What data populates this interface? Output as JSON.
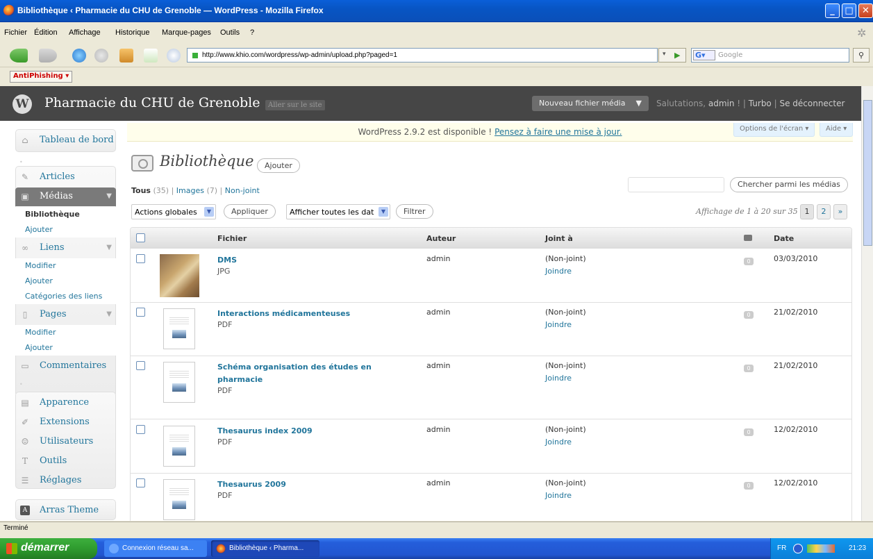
{
  "window": {
    "title": "Bibliothèque ‹ Pharmacie du CHU de Grenoble — WordPress - Mozilla Firefox"
  },
  "menubar": [
    "Fichier",
    "Édition",
    "Affichage",
    "Historique",
    "Marque-pages",
    "Outils",
    "?"
  ],
  "navbar": {
    "url": "http://www.khio.com/wordpress/wp-admin/upload.php?paged=1",
    "search_engine": "G",
    "search_placeholder": "Google"
  },
  "toolbar2": {
    "antiphishing": "AntiPhishing"
  },
  "wp": {
    "site_title": "Pharmacie du CHU de Grenoble",
    "visit_site": "Aller sur le site",
    "new_media": "Nouveau fichier média",
    "greeting": "Salutations,",
    "user": "admin",
    "turbo": "Turbo",
    "logout": "Se déconnecter",
    "update_nag_text": "WordPress 2.9.2 est disponible !",
    "update_nag_link": "Pensez à faire une mise à jour.",
    "screen_options": "Options de l'écran",
    "help": "Aide"
  },
  "sidebar": {
    "dashboard": "Tableau de bord",
    "articles": "Articles",
    "medias": "Médias",
    "medias_sub": [
      "Bibliothèque",
      "Ajouter"
    ],
    "liens": "Liens",
    "liens_sub": [
      "Modifier",
      "Ajouter",
      "Catégories des liens"
    ],
    "pages": "Pages",
    "pages_sub": [
      "Modifier",
      "Ajouter"
    ],
    "commentaires": "Commentaires",
    "apparence": "Apparence",
    "extensions": "Extensions",
    "utilisateurs": "Utilisateurs",
    "outils": "Outils",
    "reglages": "Réglages",
    "theme": "Arras Theme"
  },
  "main": {
    "title": "Bibliothèque",
    "add_button": "Ajouter",
    "filters": {
      "all": "Tous",
      "all_count": "(35)",
      "images": "Images",
      "images_count": "(7)",
      "unattached": "Non-joint"
    },
    "search_button": "Chercher parmi les médias",
    "bulk_actions": "Actions globales",
    "apply": "Appliquer",
    "date_filter": "Afficher toutes les dat",
    "filter_button": "Filtrer",
    "pagination_info": "Affichage de 1 à 20 sur 35",
    "pages": [
      "1",
      "2",
      "»"
    ],
    "columns": {
      "file": "Fichier",
      "author": "Auteur",
      "attached": "Joint à",
      "date": "Date"
    },
    "rows": [
      {
        "name": "DMS",
        "type": "JPG",
        "author": "admin",
        "attached": "(Non-joint)",
        "attach_link": "Joindre",
        "comments": "0",
        "date": "03/03/2010",
        "thumb": "photo"
      },
      {
        "name": "Interactions médicamenteuses",
        "type": "PDF",
        "author": "admin",
        "attached": "(Non-joint)",
        "attach_link": "Joindre",
        "comments": "0",
        "date": "21/02/2010",
        "thumb": "pdf"
      },
      {
        "name": "Schéma organisation des études en pharmacie",
        "type": "PDF",
        "author": "admin",
        "attached": "(Non-joint)",
        "attach_link": "Joindre",
        "comments": "0",
        "date": "21/02/2010",
        "thumb": "pdf"
      },
      {
        "name": "Thesaurus index 2009",
        "type": "PDF",
        "author": "admin",
        "attached": "(Non-joint)",
        "attach_link": "Joindre",
        "comments": "0",
        "date": "12/02/2010",
        "thumb": "pdf"
      },
      {
        "name": "Thesaurus 2009",
        "type": "PDF",
        "author": "admin",
        "attached": "(Non-joint)",
        "attach_link": "Joindre",
        "comments": "0",
        "date": "12/02/2010",
        "thumb": "pdf"
      }
    ]
  },
  "statusbar": {
    "text": "Terminé"
  },
  "taskbar": {
    "start": "démarrer",
    "tasks": [
      "Connexion réseau sa...",
      "Bibliothèque ‹ Pharma..."
    ],
    "lang": "FR",
    "clock": "21:23"
  },
  "colors": {
    "wp_link": "#21759b",
    "wp_header": "#464646",
    "xp_blue": "#245edb",
    "xp_green": "#2f9b2f"
  }
}
